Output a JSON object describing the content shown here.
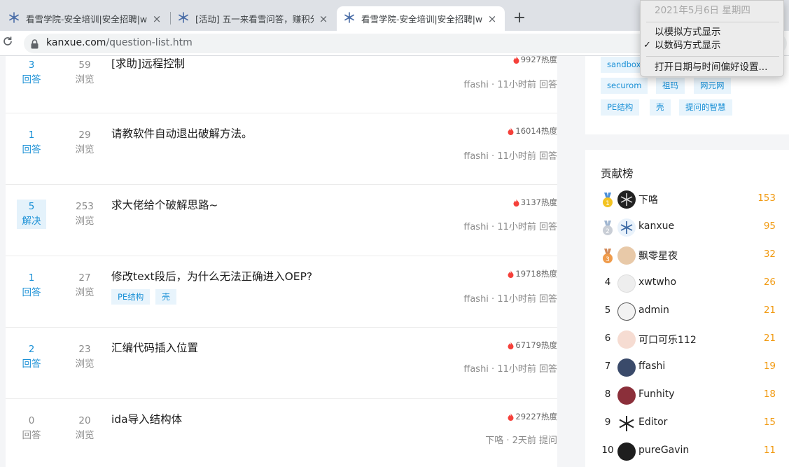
{
  "browser": {
    "tabs": [
      {
        "title": "看雪学院-安全培训|安全招聘|ww",
        "active": false
      },
      {
        "title": "[活动] 五一来看雪问答，赚积分,",
        "active": false
      },
      {
        "title": "看雪学院-安全培训|安全招聘|ww",
        "active": true
      }
    ],
    "close_glyph": "×",
    "new_tab_glyph": "+",
    "url_host": "kanxue.com",
    "url_path": "/question-list.htm"
  },
  "questions": [
    {
      "answers": "3",
      "answer_label": "回答",
      "views": "59",
      "views_label": "浏览",
      "title": "[求助]远程控制",
      "heat": "9927热度",
      "meta": "ffashi · 11小时前 回答",
      "tags": [],
      "solved": false
    },
    {
      "answers": "1",
      "answer_label": "回答",
      "views": "29",
      "views_label": "浏览",
      "title": "请教软件自动退出破解方法。",
      "heat": "16014热度",
      "meta": "ffashi · 11小时前 回答",
      "tags": [],
      "solved": false
    },
    {
      "answers": "5",
      "answer_label": "解决",
      "views": "253",
      "views_label": "浏览",
      "title": "求大佬给个破解思路~",
      "heat": "3137热度",
      "meta": "ffashi · 11小时前 回答",
      "tags": [],
      "solved": true
    },
    {
      "answers": "1",
      "answer_label": "回答",
      "views": "27",
      "views_label": "浏览",
      "title": "修改text段后，为什么无法正确进入OEP?",
      "heat": "19718热度",
      "meta": "ffashi · 11小时前 回答",
      "tags": [
        "PE结构",
        "壳"
      ],
      "solved": false
    },
    {
      "answers": "2",
      "answer_label": "回答",
      "views": "23",
      "views_label": "浏览",
      "title": "汇编代码插入位置",
      "heat": "67179热度",
      "meta": "ffashi · 11小时前 回答",
      "tags": [],
      "solved": false
    },
    {
      "answers": "0",
      "answer_label": "回答",
      "views": "20",
      "views_label": "浏览",
      "title": "ida导入结构体",
      "heat": "29227热度",
      "meta": "下咯 · 2天前 提问",
      "tags": [],
      "solved": false
    }
  ],
  "sidebar": {
    "tags": [
      "sandbox",
      "securom",
      "祖玛",
      "网元网",
      "PE结构",
      "壳",
      "提问的智慧"
    ],
    "ranking_title": "贡献榜",
    "ranking": [
      {
        "rank": "1",
        "name": "下咯",
        "score": "153",
        "medal": "gold"
      },
      {
        "rank": "2",
        "name": "kanxue",
        "score": "95",
        "medal": "silver"
      },
      {
        "rank": "3",
        "name": "飘零星夜",
        "score": "32",
        "medal": "bronze"
      },
      {
        "rank": "4",
        "name": "xwtwho",
        "score": "26",
        "medal": ""
      },
      {
        "rank": "5",
        "name": "admin",
        "score": "21",
        "medal": ""
      },
      {
        "rank": "6",
        "name": "可口可乐112",
        "score": "21",
        "medal": ""
      },
      {
        "rank": "7",
        "name": "ffashi",
        "score": "19",
        "medal": ""
      },
      {
        "rank": "8",
        "name": "Funhity",
        "score": "18",
        "medal": ""
      },
      {
        "rank": "9",
        "name": "Editor",
        "score": "15",
        "medal": ""
      },
      {
        "rank": "10",
        "name": "pureGavin",
        "score": "11",
        "medal": ""
      }
    ]
  },
  "clock_menu": {
    "date": "2021年5月6日 星期四",
    "items": [
      {
        "label": "以模拟方式显示",
        "checked": false
      },
      {
        "label": "以数码方式显示",
        "checked": true
      }
    ],
    "prefs": "打开日期与时间偏好设置...",
    "check_glyph": "✓"
  },
  "colors": {
    "accent_blue": "#1a90d6",
    "heat_red": "#f5403a",
    "score_orange": "#f19a12"
  }
}
